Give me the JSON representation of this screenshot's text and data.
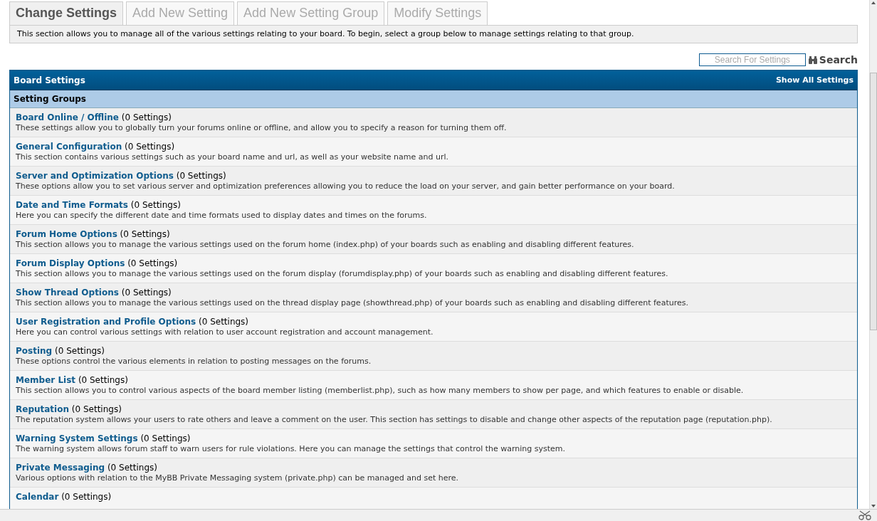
{
  "tabs": [
    {
      "label": "Change Settings",
      "selected": true
    },
    {
      "label": "Add New Setting",
      "selected": false
    },
    {
      "label": "Add New Setting Group",
      "selected": false
    },
    {
      "label": "Modify Settings",
      "selected": false
    }
  ],
  "intro": "This section allows you to manage all of the various settings relating to your board. To begin, select a group below to manage settings relating to that group.",
  "search": {
    "placeholder": "Search For Settings",
    "button": "Search"
  },
  "table": {
    "title": "Board Settings",
    "link": "Show All Settings",
    "subheader": "Setting Groups",
    "rows": [
      {
        "name": "Board Online / Offline",
        "count": "(0 Settings)",
        "description": "These settings allow you to globally turn your forums online or offline, and allow you to specify a reason for turning them off."
      },
      {
        "name": "General Configuration",
        "count": "(0 Settings)",
        "description": "This section contains various settings such as your board name and url, as well as your website name and url."
      },
      {
        "name": "Server and Optimization Options",
        "count": "(0 Settings)",
        "description": "These options allow you to set various server and optimization preferences allowing you to reduce the load on your server, and gain better performance on your board."
      },
      {
        "name": "Date and Time Formats",
        "count": "(0 Settings)",
        "description": "Here you can specify the different date and time formats used to display dates and times on the forums."
      },
      {
        "name": "Forum Home Options",
        "count": "(0 Settings)",
        "description": "This section allows you to manage the various settings used on the forum home (index.php) of your boards such as enabling and disabling different features."
      },
      {
        "name": "Forum Display Options",
        "count": "(0 Settings)",
        "description": "This section allows you to manage the various settings used on the forum display (forumdisplay.php) of your boards such as enabling and disabling different features."
      },
      {
        "name": "Show Thread Options",
        "count": "(0 Settings)",
        "description": "This section allows you to manage the various settings used on the thread display page (showthread.php) of your boards such as enabling and disabling different features."
      },
      {
        "name": "User Registration and Profile Options",
        "count": "(0 Settings)",
        "description": "Here you can control various settings with relation to user account registration and account management."
      },
      {
        "name": "Posting",
        "count": "(0 Settings)",
        "description": "These options control the various elements in relation to posting messages on the forums."
      },
      {
        "name": "Member List",
        "count": "(0 Settings)",
        "description": "This section allows you to control various aspects of the board member listing (memberlist.php), such as how many members to show per page, and which features to enable or disable."
      },
      {
        "name": "Reputation",
        "count": "(0 Settings)",
        "description": "The reputation system allows your users to rate others and leave a comment on the user. This section has settings to disable and change other aspects of the reputation page (reputation.php)."
      },
      {
        "name": "Warning System Settings",
        "count": "(0 Settings)",
        "description": "The warning system allows forum staff to warn users for rule violations. Here you can manage the settings that control the warning system."
      },
      {
        "name": "Private Messaging",
        "count": "(0 Settings)",
        "description": "Various options with relation to the MyBB Private Messaging system (private.php) can be managed and set here."
      },
      {
        "name": "Calendar",
        "count": "(0 Settings)"
      }
    ]
  }
}
